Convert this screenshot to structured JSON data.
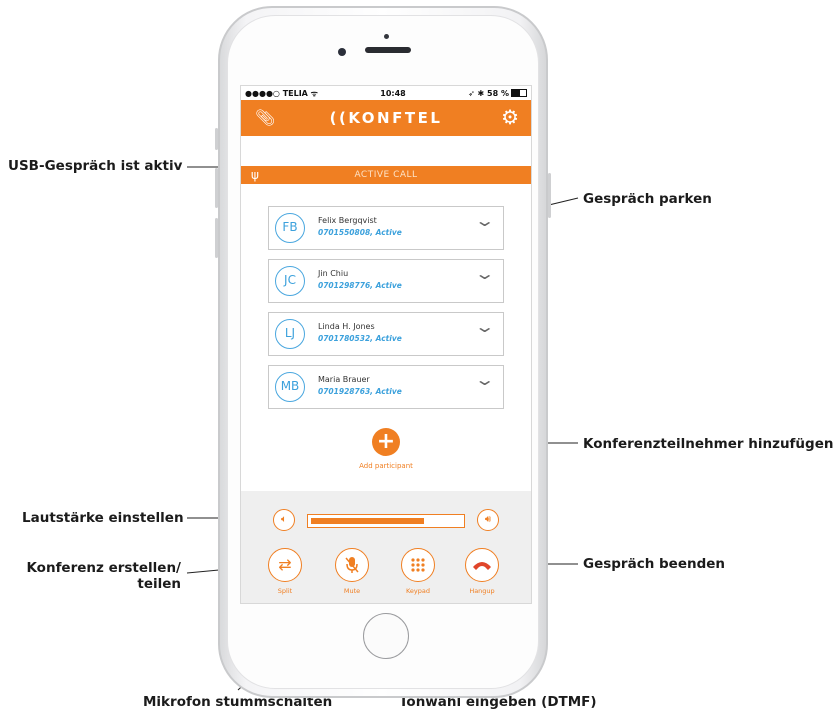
{
  "callouts": {
    "usb": "USB-Gespräch ist aktiv",
    "park": "Gespräch parken",
    "add": "Konferenzteilnehmer hinzufügen",
    "volume": "Lautstärke einstellen",
    "conference_line1": "Konferenz erstellen/",
    "conference_line2": "teilen",
    "hangup": "Gespräch beenden",
    "mute": "Mikrofon stummschalten",
    "dtmf": "Tonwahl eingeben (DTMF)"
  },
  "status_bar": {
    "carrier": "●●●●○ TELIA ᯤ",
    "time": "10:48",
    "battery": "➶ ✱ 58 %"
  },
  "app": {
    "title": "((KONFTEL",
    "active_call_label": "ACTIVE CALL"
  },
  "participants": [
    {
      "initials": "FB",
      "name": "Felix Bergqvist",
      "detail": "0701550808, Active"
    },
    {
      "initials": "JC",
      "name": "Jin Chiu",
      "detail": "0701298776, Active"
    },
    {
      "initials": "LJ",
      "name": "Linda H. Jones",
      "detail": "0701780532, Active"
    },
    {
      "initials": "MB",
      "name": "Maria Brauer",
      "detail": "0701928763, Active"
    }
  ],
  "add_participant_label": "Add participant",
  "volume_level": 0.75,
  "actions": {
    "split": "Split",
    "mute": "Mute",
    "keypad": "Keypad",
    "hangup": "Hangup"
  },
  "colors": {
    "accent": "#f07f22",
    "avatar_blue": "#3ca1dc"
  },
  "icons": {
    "clip": "paperclip-icon",
    "gear": "gear-icon",
    "usb": "usb-icon",
    "chevron": "chevron-down-icon",
    "volume_down": "volume-down-icon",
    "volume_up": "volume-up-icon",
    "split": "split-arrows-icon",
    "mute": "microphone-muted-icon",
    "keypad": "keypad-icon",
    "hangup": "phone-hangup-icon"
  }
}
